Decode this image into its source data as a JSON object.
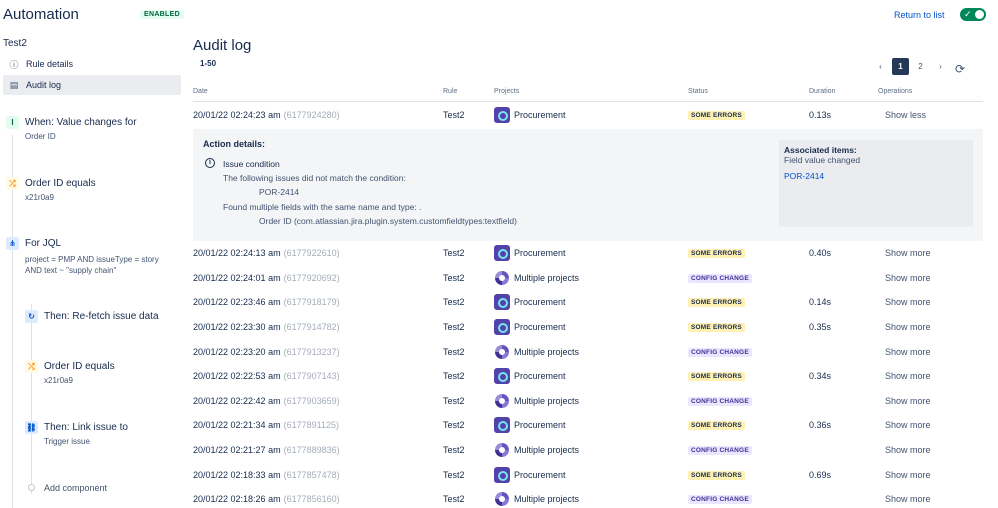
{
  "app": {
    "title": "Automation",
    "badge": "ENABLED",
    "return_label": "Return to list",
    "toggle_check": "✓"
  },
  "sidebar": {
    "rule_name": "Test2",
    "nav": [
      {
        "label": "Rule details",
        "icon": "ⓘ"
      },
      {
        "label": "Audit log",
        "icon": "▤"
      }
    ],
    "components": [
      {
        "title": "When: Value changes for",
        "sub": [
          "Order ID"
        ],
        "icon": "I"
      },
      {
        "title": "Order ID equals",
        "sub": [
          "x21r0a9"
        ],
        "icon": "⤮"
      },
      {
        "title": "For JQL",
        "sub": [
          "project = PMP AND issueType = story",
          "AND text ~ \"supply chain\""
        ],
        "icon": "⋔"
      },
      {
        "title": "Then: Re-fetch issue data",
        "sub": [],
        "icon": "↻"
      },
      {
        "title": "Order ID equals",
        "sub": [
          "x21r0a9"
        ],
        "icon": "⤮"
      },
      {
        "title": "Then: Link issue to",
        "sub": [
          "Trigger issue"
        ],
        "icon": "⛓"
      }
    ],
    "add_component": "Add component"
  },
  "main": {
    "title": "Audit log",
    "range": "1-50",
    "pager": {
      "prev": "‹",
      "pages": [
        "1",
        "2"
      ],
      "next": "›",
      "refresh": "⟳"
    },
    "columns": [
      "Date",
      "Rule",
      "Projects",
      "Status",
      "Duration",
      "Operations"
    ],
    "rows": [
      {
        "date": "20/01/22 02:24:23 am",
        "id": "(6177924280)",
        "rule": "Test2",
        "project": "Procurement",
        "ptype": "single",
        "status": "SOME ERRORS",
        "stype": "err",
        "duration": "0.13s",
        "op": "Show less"
      },
      {
        "date": "20/01/22 02:24:13 am",
        "id": "(6177922610)",
        "rule": "Test2",
        "project": "Procurement",
        "ptype": "single",
        "status": "SOME ERRORS",
        "stype": "err",
        "duration": "0.40s",
        "op": "Show more"
      },
      {
        "date": "20/01/22 02:24:01 am",
        "id": "(6177920692)",
        "rule": "Test2",
        "project": "Multiple projects",
        "ptype": "multi",
        "status": "CONFIG CHANGE",
        "stype": "cfg",
        "duration": "",
        "op": "Show more"
      },
      {
        "date": "20/01/22 02:23:46 am",
        "id": "(6177918179)",
        "rule": "Test2",
        "project": "Procurement",
        "ptype": "single",
        "status": "SOME ERRORS",
        "stype": "err",
        "duration": "0.14s",
        "op": "Show more"
      },
      {
        "date": "20/01/22 02:23:30 am",
        "id": "(6177914782)",
        "rule": "Test2",
        "project": "Procurement",
        "ptype": "single",
        "status": "SOME ERRORS",
        "stype": "err",
        "duration": "0.35s",
        "op": "Show more"
      },
      {
        "date": "20/01/22 02:23:20 am",
        "id": "(6177913237)",
        "rule": "Test2",
        "project": "Multiple projects",
        "ptype": "multi",
        "status": "CONFIG CHANGE",
        "stype": "cfg",
        "duration": "",
        "op": "Show more"
      },
      {
        "date": "20/01/22 02:22:53 am",
        "id": "(6177907143)",
        "rule": "Test2",
        "project": "Procurement",
        "ptype": "single",
        "status": "SOME ERRORS",
        "stype": "err",
        "duration": "0.34s",
        "op": "Show more"
      },
      {
        "date": "20/01/22 02:22:42 am",
        "id": "(6177903659)",
        "rule": "Test2",
        "project": "Multiple projects",
        "ptype": "multi",
        "status": "CONFIG CHANGE",
        "stype": "cfg",
        "duration": "",
        "op": "Show more"
      },
      {
        "date": "20/01/22 02:21:34 am",
        "id": "(6177891125)",
        "rule": "Test2",
        "project": "Procurement",
        "ptype": "single",
        "status": "SOME ERRORS",
        "stype": "err",
        "duration": "0.36s",
        "op": "Show more"
      },
      {
        "date": "20/01/22 02:21:27 am",
        "id": "(6177889836)",
        "rule": "Test2",
        "project": "Multiple projects",
        "ptype": "multi",
        "status": "CONFIG CHANGE",
        "stype": "cfg",
        "duration": "",
        "op": "Show more"
      },
      {
        "date": "20/01/22 02:18:33 am",
        "id": "(6177857478)",
        "rule": "Test2",
        "project": "Procurement",
        "ptype": "single",
        "status": "SOME ERRORS",
        "stype": "err",
        "duration": "0.69s",
        "op": "Show more"
      },
      {
        "date": "20/01/22 02:18:26 am",
        "id": "(6177856160)",
        "rule": "Test2",
        "project": "Multiple projects",
        "ptype": "multi",
        "status": "CONFIG CHANGE",
        "stype": "cfg",
        "duration": "",
        "op": "Show more"
      }
    ],
    "details": {
      "title": "Action details:",
      "info_icon": "i",
      "lines": [
        "Issue condition",
        "The following issues did not match the condition:",
        "POR-2414",
        "Found multiple fields with the same name and type: .",
        "Order ID (com.atlassian.jira.plugin.system.customfieldtypes:textfield)"
      ],
      "associated_title": "Associated items:",
      "associated_sub": "Field value changed",
      "associated_link": "POR-2414"
    }
  },
  "colors": {
    "accent": "#0052cc",
    "toggle": "#00875a",
    "error_bg": "#fff0b3",
    "config_bg": "#eae6ff"
  }
}
